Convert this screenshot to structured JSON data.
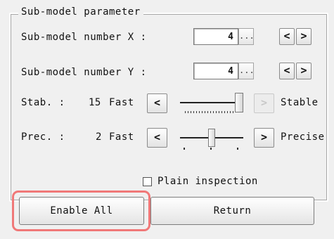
{
  "group": {
    "title": "Sub-model parameter"
  },
  "sub_x": {
    "label": "Sub-model number X :",
    "value": "4",
    "ellipsis": "...",
    "prev": "<",
    "next": ">"
  },
  "sub_y": {
    "label": "Sub-model number Y :",
    "value": "4",
    "ellipsis": "...",
    "prev": "<",
    "next": ">"
  },
  "stab": {
    "label": "Stab. :",
    "value": "15",
    "left_label": "Fast",
    "right_label": "Stable",
    "dec": "<",
    "inc": ">",
    "level_fraction": 1.0
  },
  "prec": {
    "label": "Prec. :",
    "value": "2",
    "left_label": "Fast",
    "right_label": "Precise",
    "dec": "<",
    "inc": ">",
    "level_fraction": 0.5
  },
  "plain_inspection": {
    "label": "Plain inspection",
    "checked": false
  },
  "buttons": {
    "enable_all": "Enable All",
    "return": "Return"
  },
  "colors": {
    "highlight": "#f07878",
    "background": "#f0f0f0"
  }
}
